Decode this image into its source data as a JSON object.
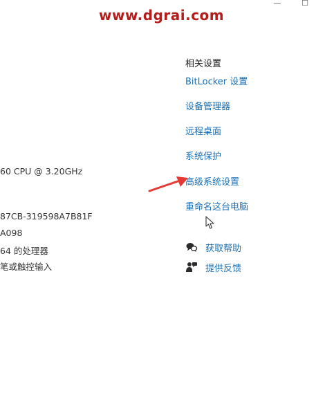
{
  "watermark": "www.dgrai.com",
  "window_controls": {
    "minimize": "—",
    "maximize": "☐"
  },
  "system_specs": [
    "60  CPU @ 3.20GHz",
    "87CB-319598A7B81F",
    "A098",
    "64 的处理器",
    "笔或触控输入"
  ],
  "related_settings": {
    "heading": "相关设置",
    "links": [
      "BitLocker 设置",
      "设备管理器",
      "远程桌面",
      "系统保护",
      "高级系统设置",
      "重命名这台电脑"
    ]
  },
  "help": {
    "get_help": "获取帮助",
    "give_feedback": "提供反馈"
  },
  "colors": {
    "link": "#1a6fb5",
    "watermark": "#b51c1c",
    "arrow": "#e53935"
  }
}
